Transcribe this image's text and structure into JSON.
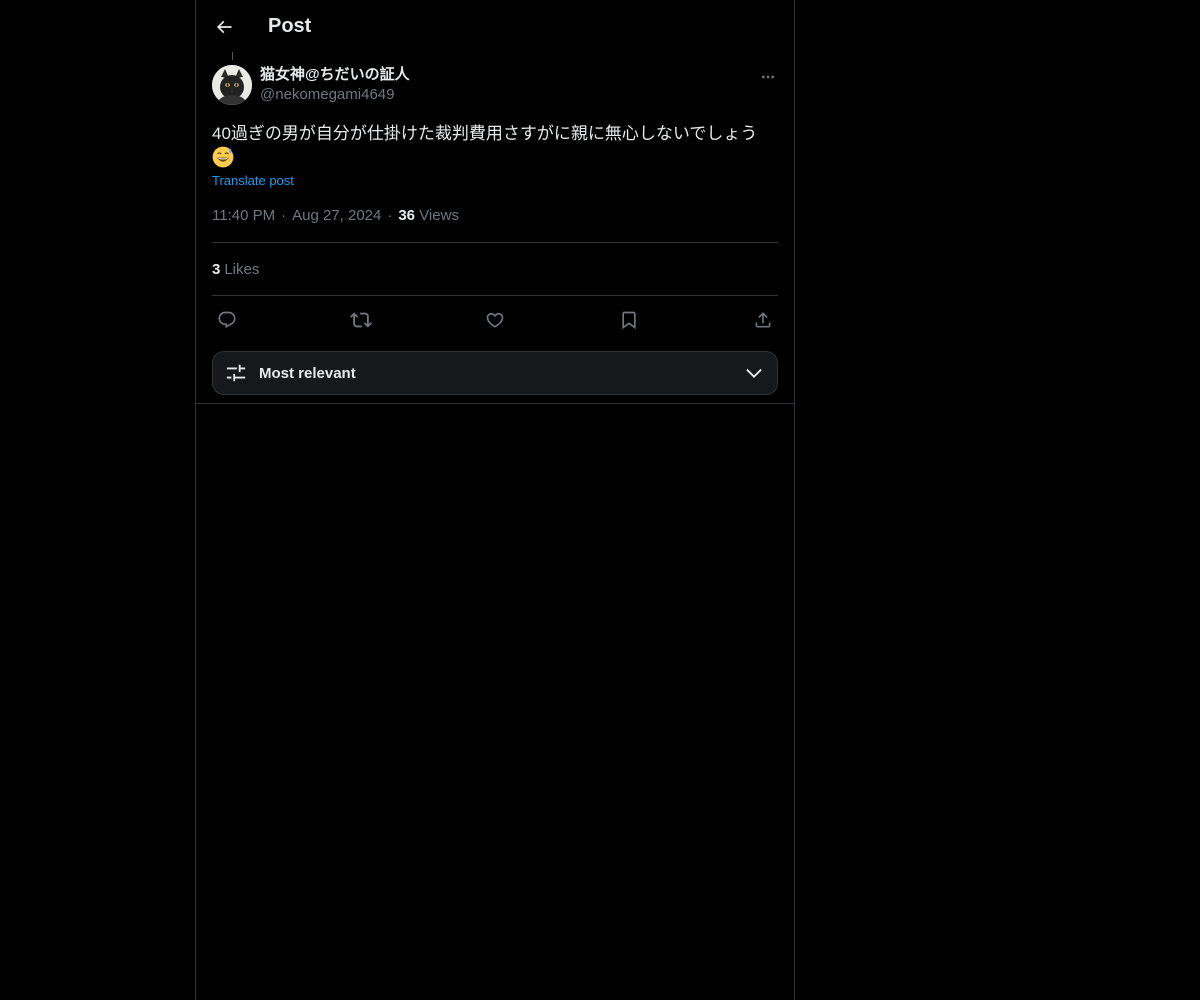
{
  "header": {
    "title": "Post",
    "back_icon": "arrow-left-icon"
  },
  "post": {
    "author": {
      "display_name": "猫女神@ちだいの証人",
      "handle": "@nekomegami4649"
    },
    "text": "40過ぎの男が自分が仕掛けた裁判費用さすがに親に無心しないでしょう",
    "emoji": "grinning-sweat-emoji",
    "translate_label": "Translate post",
    "time": "11:40 PM",
    "date": "Aug 27, 2024",
    "views_count": "36",
    "views_label": "Views",
    "separator": "·",
    "likes_count": "3",
    "likes_label": "Likes"
  },
  "actions": {
    "icons": [
      "reply-icon",
      "repost-icon",
      "like-icon",
      "bookmark-icon",
      "share-icon"
    ]
  },
  "replies_sort": {
    "icon": "sliders-icon",
    "label": "Most relevant",
    "chevron": "chevron-down-icon"
  },
  "colors": {
    "background": "#000000",
    "text": "#e7e9ea",
    "secondary": "#71767b",
    "link": "#1d9bf0",
    "border": "#2f3336"
  }
}
